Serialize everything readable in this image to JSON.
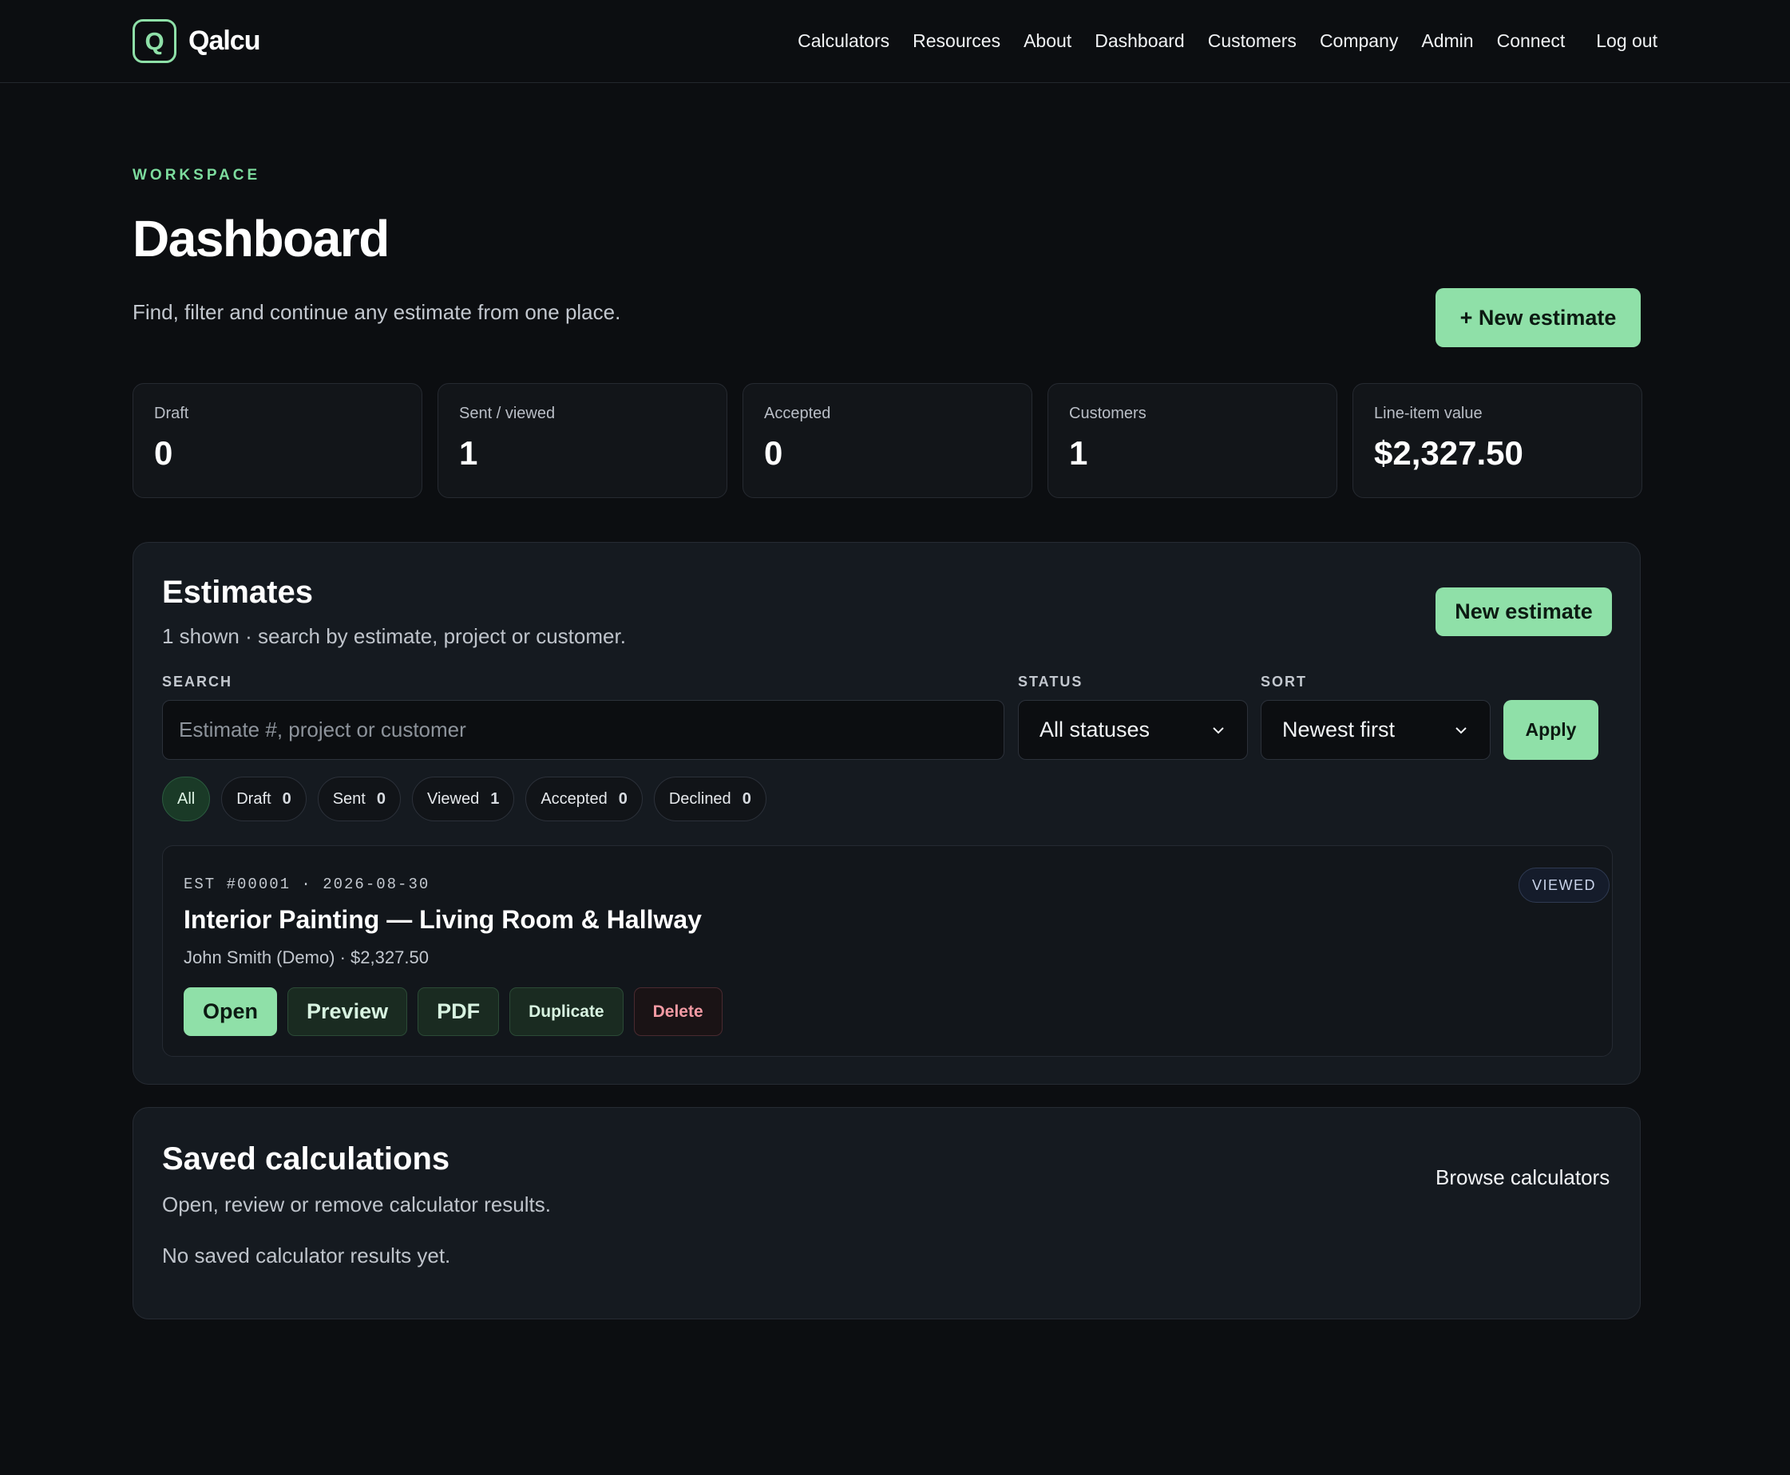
{
  "app": {
    "logo_letter": "Q",
    "name": "Qalcu"
  },
  "nav": {
    "items": [
      "Calculators",
      "Resources",
      "About",
      "Dashboard",
      "Customers",
      "Company",
      "Admin",
      "Connect"
    ],
    "logout": "Log out"
  },
  "header": {
    "eyebrow": "WORKSPACE",
    "title": "Dashboard",
    "subtitle": "Find, filter and continue any estimate from one place.",
    "new_estimate_label": "+ New estimate"
  },
  "stats": [
    {
      "label": "Draft",
      "value": "0"
    },
    {
      "label": "Sent / viewed",
      "value": "1"
    },
    {
      "label": "Accepted",
      "value": "0"
    },
    {
      "label": "Customers",
      "value": "1"
    },
    {
      "label": "Line-item value",
      "value": "$2,327.50"
    }
  ],
  "estimates": {
    "title": "Estimates",
    "subtitle": "1 shown · search by estimate, project or customer.",
    "new_label": "New estimate",
    "search": {
      "label": "SEARCH",
      "value": "",
      "placeholder": "Estimate #, project or customer"
    },
    "status": {
      "label": "STATUS",
      "selected": "All statuses"
    },
    "sort": {
      "label": "SORT",
      "selected": "Newest first"
    },
    "apply_label": "Apply",
    "chips": [
      {
        "label": "All",
        "count": "",
        "active": true
      },
      {
        "label": "Draft",
        "count": "0"
      },
      {
        "label": "Sent",
        "count": "0"
      },
      {
        "label": "Viewed",
        "count": "1"
      },
      {
        "label": "Accepted",
        "count": "0"
      },
      {
        "label": "Declined",
        "count": "0"
      }
    ],
    "card": {
      "meta": "EST #00001 · 2026-08-30",
      "title": "Interior Painting — Living Room & Hallway",
      "customer": "John Smith (Demo) · $2,327.50",
      "badge": "VIEWED",
      "actions": {
        "open": "Open",
        "preview": "Preview",
        "pdf": "PDF",
        "duplicate": "Duplicate",
        "delete": "Delete"
      }
    }
  },
  "saved": {
    "title": "Saved calculations",
    "subtitle": "Open, review or remove calculator results.",
    "browse_label": "Browse calculators",
    "empty_text": "No saved calculator results yet."
  }
}
